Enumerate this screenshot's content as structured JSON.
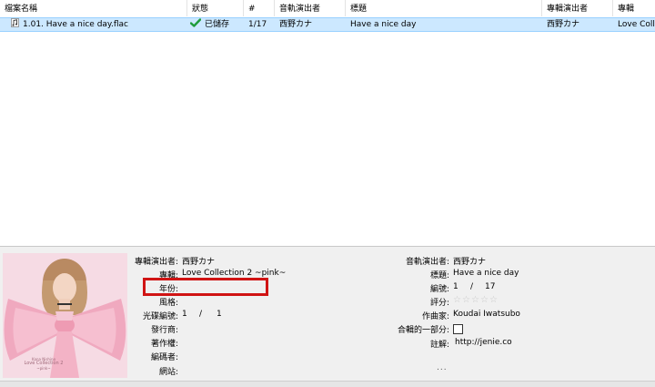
{
  "columns": [
    {
      "key": "filename",
      "label": "檔案名稱"
    },
    {
      "key": "status",
      "label": "狀態"
    },
    {
      "key": "number",
      "label": "#"
    },
    {
      "key": "track_artist",
      "label": "音軌演出者"
    },
    {
      "key": "title",
      "label": "標題"
    },
    {
      "key": "album_artist",
      "label": "專輯演出者"
    },
    {
      "key": "album",
      "label": "專輯"
    }
  ],
  "files": [
    {
      "filename": "1.01. Have a nice day.flac",
      "status": "已儲存",
      "number": "1/17",
      "track_artist": "西野カナ",
      "title": "Have a nice day",
      "album_artist": "西野カナ",
      "album": "Love Collec"
    }
  ],
  "details": {
    "left": {
      "album_artist": {
        "label": "專輯演出者:",
        "value": "西野カナ"
      },
      "album": {
        "label": "專輯:",
        "value": "Love Collection 2 ~pink~"
      },
      "year": {
        "label": "年份:",
        "value": ""
      },
      "genre": {
        "label": "風格:",
        "value": ""
      },
      "disc_number": {
        "label": "光碟編號:",
        "value": "1",
        "sep": "/",
        "total": "1"
      },
      "publisher": {
        "label": "發行商:",
        "value": ""
      },
      "copyright": {
        "label": "著作權:",
        "value": ""
      },
      "encoded_by": {
        "label": "編碼者:",
        "value": ""
      },
      "url": {
        "label": "網站:",
        "value": ""
      }
    },
    "right": {
      "track_artist": {
        "label": "音軌演出者:",
        "value": "西野カナ"
      },
      "title": {
        "label": "標題:",
        "value": "Have a nice day"
      },
      "track_number": {
        "label": "編號:",
        "value": "1",
        "sep": "/",
        "total": "17"
      },
      "rating": {
        "label": "評分:",
        "value": 0,
        "max": 5
      },
      "composer": {
        "label": "作曲家:",
        "value": "Koudai Iwatsubo"
      },
      "compilation": {
        "label": "合輯的一部分:",
        "checked": false
      },
      "comment": {
        "label": "註解:",
        "value": "http://jenie.co"
      },
      "more": "..."
    },
    "cover_art": {
      "artist_text": "Kana Nishino",
      "title_text": "Love Collection 2",
      "sub_text": "~pink~"
    }
  },
  "colors": {
    "selection": "#cce8ff",
    "check": "#1e9c3a",
    "highlight": "#d01414"
  }
}
